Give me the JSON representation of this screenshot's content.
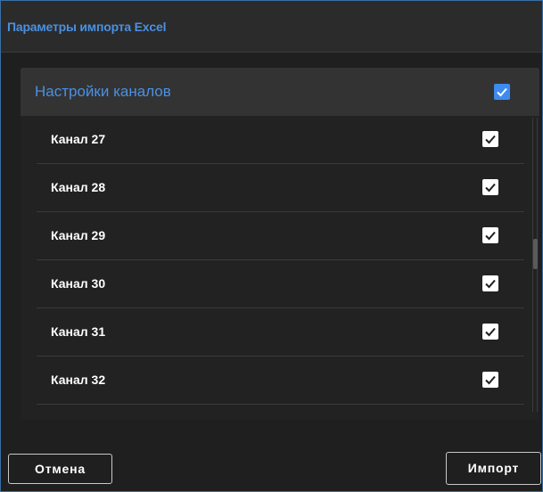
{
  "window": {
    "title": "Параметры импорта Excel"
  },
  "panel": {
    "header_label": "Настройки каналов",
    "header_checked": true,
    "channels": [
      {
        "label": "Канал 27",
        "checked": true
      },
      {
        "label": "Канал 28",
        "checked": true
      },
      {
        "label": "Канал 29",
        "checked": true
      },
      {
        "label": "Канал 30",
        "checked": true
      },
      {
        "label": "Канал 31",
        "checked": true
      },
      {
        "label": "Канал 32",
        "checked": true
      }
    ]
  },
  "footer": {
    "cancel_label": "Отмена",
    "import_label": "Импорт"
  },
  "colors": {
    "accent": "#4a90e2",
    "checkbox_accent": "#3d8bf0",
    "background": "#1f1f1f",
    "panel_header": "#333333"
  }
}
